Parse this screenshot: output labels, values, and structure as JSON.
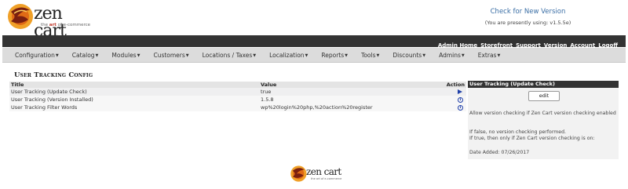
{
  "brand": {
    "logo_text": "zen cart",
    "tagline_pre": "the ",
    "tagline_art": "art",
    "tagline_post": " of e-commerce"
  },
  "version": {
    "link": "Check for New Version",
    "note": "(You are presently using: v1.5.5e)"
  },
  "admin_bar": {
    "items": [
      "Admin Home",
      "Storefront",
      "Support",
      "Version",
      "Account",
      "Logoff"
    ]
  },
  "menu": {
    "items": [
      "Configuration",
      "Catalog",
      "Modules",
      "Customers",
      "Locations / Taxes",
      "Localization",
      "Reports",
      "Tools",
      "Discounts",
      "Admins",
      "Extras"
    ]
  },
  "page": {
    "title": "User Tracking Config"
  },
  "table": {
    "headers": {
      "title": "Title",
      "value": "Value",
      "action": "Action"
    },
    "rows": [
      {
        "title": "User Tracking (Update Check)",
        "value": "true",
        "action_icon": "arrow-right-icon"
      },
      {
        "title": "User Tracking (Version Installed)",
        "value": "1.5.8",
        "action_icon": "info-icon"
      },
      {
        "title": "User Tracking Filter Words",
        "value": "wp%20login%20php,%20action%20register",
        "action_icon": "info-icon"
      }
    ]
  },
  "info_box": {
    "header": "User Tracking (Update Check)",
    "button": "edit",
    "text1": "Allow version checking if Zen Cart version checking enabled",
    "text2": "If false, no version checking performed.\nIf true, then only if Zen Cart version checking is on:",
    "date": "Date Added: 07/26/2017"
  },
  "footer": {
    "logo_text": "zen cart",
    "tagline": "the art of e-commerce"
  },
  "colors": {
    "admin_bar_bg": "#333333",
    "menu_bg": "#dcdcdc",
    "link": "#3a6ea5",
    "icon_blue": "#1f3fa8"
  }
}
